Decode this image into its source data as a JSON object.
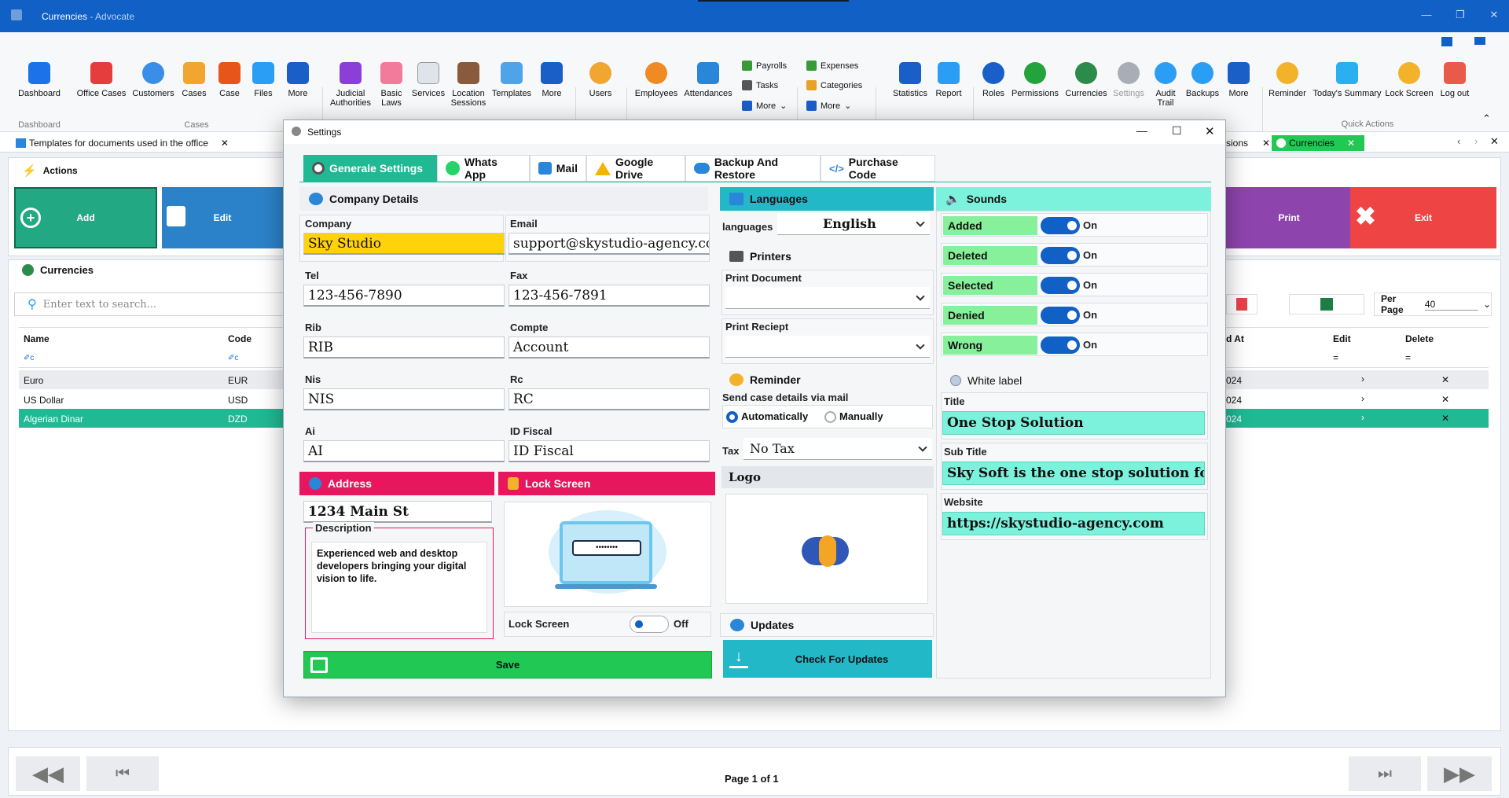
{
  "window": {
    "title": "Currencies",
    "app": " - Advocate"
  },
  "ribbon": {
    "dashboard": "Dashboard",
    "office_cases": "Office Cases",
    "customers": "Customers",
    "cases": "Cases",
    "case": "Case",
    "files": "Files",
    "more1": "More",
    "judicial": "Judicial\nAuthorities",
    "basic_laws": "Basic\nLaws",
    "services": "Services",
    "location": "Location\nSessions",
    "templates": "Templates",
    "more2": "More",
    "users": "Users",
    "employees": "Employees",
    "attendances": "Attendances",
    "payrolls": "Payrolls",
    "tasks": "Tasks",
    "more3": "More",
    "expenses": "Expenses",
    "categories": "Categories",
    "more4": "More",
    "statistics": "Statistics",
    "report": "Report",
    "roles": "Roles",
    "permissions": "Permissions",
    "currencies": "Currencies",
    "settings": "Settings",
    "audit": "Audit\nTrail",
    "backups": "Backups",
    "more5": "More",
    "reminder": "Reminder",
    "summary": "Today's Summary",
    "lock": "Lock Screen",
    "logout": "Log out",
    "grp_dashboard": "Dashboard",
    "grp_cases": "Cases",
    "grp_quick": "Quick Actions"
  },
  "tabs": {
    "templates_tab": "Templates for documents used in the office",
    "sessions_tab": "sions",
    "currencies_tab": "Currencies"
  },
  "actions": {
    "title": "Actions",
    "add": "Add",
    "edit": "Edit",
    "print": "Print",
    "exit": "Exit"
  },
  "grid": {
    "title": "Currencies",
    "search_placeholder": "Enter text to search...",
    "per_page_label": "Per Page",
    "per_page": "40",
    "col_name": "Name",
    "col_code": "Code",
    "col_at": "d At",
    "col_edit": "Edit",
    "col_delete": "Delete",
    "rows": [
      {
        "name": "Euro",
        "code": "EUR",
        "at": "024"
      },
      {
        "name": "US Dollar",
        "code": "USD",
        "at": "024"
      },
      {
        "name": "Algerian Dinar",
        "code": "DZD",
        "at": "024"
      }
    ]
  },
  "pager": {
    "text": "Page 1 of 1"
  },
  "dialog": {
    "title": "Settings",
    "tabs": [
      "Generale Settings",
      "Whats App",
      "Mail",
      "Google Drive",
      "Backup And Restore",
      "Purchase Code"
    ],
    "company_details": "Company Details",
    "company_label": "Company",
    "company": "Sky Studio",
    "email_label": "Email",
    "email": "support@skystudio-agency.com",
    "tel_label": "Tel",
    "tel": "123-456-7890",
    "fax_label": "Fax",
    "fax": "123-456-7891",
    "rib_label": "Rib",
    "rib": "RIB",
    "compte_label": "Compte",
    "compte": "Account",
    "nis_label": "Nis",
    "nis": "NIS",
    "rc_label": "Rc",
    "rc": "RC",
    "ai_label": "Ai",
    "ai": "AI",
    "idf_label": "ID Fiscal",
    "idf": "ID Fiscal",
    "address_header": "Address",
    "address": "1234 Main St",
    "description_label": "Description",
    "description": "Experienced web and desktop developers bringing your digital vision to life.",
    "lock_header": "Lock Screen",
    "lock_label": "Lock Screen",
    "lock_state": "Off",
    "save": "Save",
    "languages_header": "Languages",
    "languages_label": "languages",
    "language": "English",
    "printers_header": "Printers",
    "print_document": "Print Document",
    "print_receipt": "Print Reciept",
    "reminder_header": "Reminder",
    "send_case": "Send case details via mail",
    "auto": "Automatically",
    "manual": "Manually",
    "tax_label": "Tax",
    "tax": "No Tax",
    "logo_label": "Logo",
    "updates_header": "Updates",
    "check_updates": "Check For Updates",
    "sounds_header": "Sounds",
    "sounds": [
      {
        "name": "Added",
        "state": "On"
      },
      {
        "name": "Deleted",
        "state": "On"
      },
      {
        "name": "Selected",
        "state": "On"
      },
      {
        "name": "Denied",
        "state": "On"
      },
      {
        "name": "Wrong",
        "state": "On"
      }
    ],
    "white_label_header": "White label",
    "wl_title_label": "Title",
    "wl_title": "One Stop Solution",
    "wl_sub_label": "Sub Title",
    "wl_sub": "Sky Soft is the one stop solution for all y",
    "wl_site_label": "Website",
    "wl_site": "https://skystudio-agency.com"
  },
  "colors": {
    "accent": "#1060c5",
    "green": "#21c954",
    "teal": "#22b8c8",
    "pink": "#e8175d",
    "sound": "#87f09a"
  }
}
